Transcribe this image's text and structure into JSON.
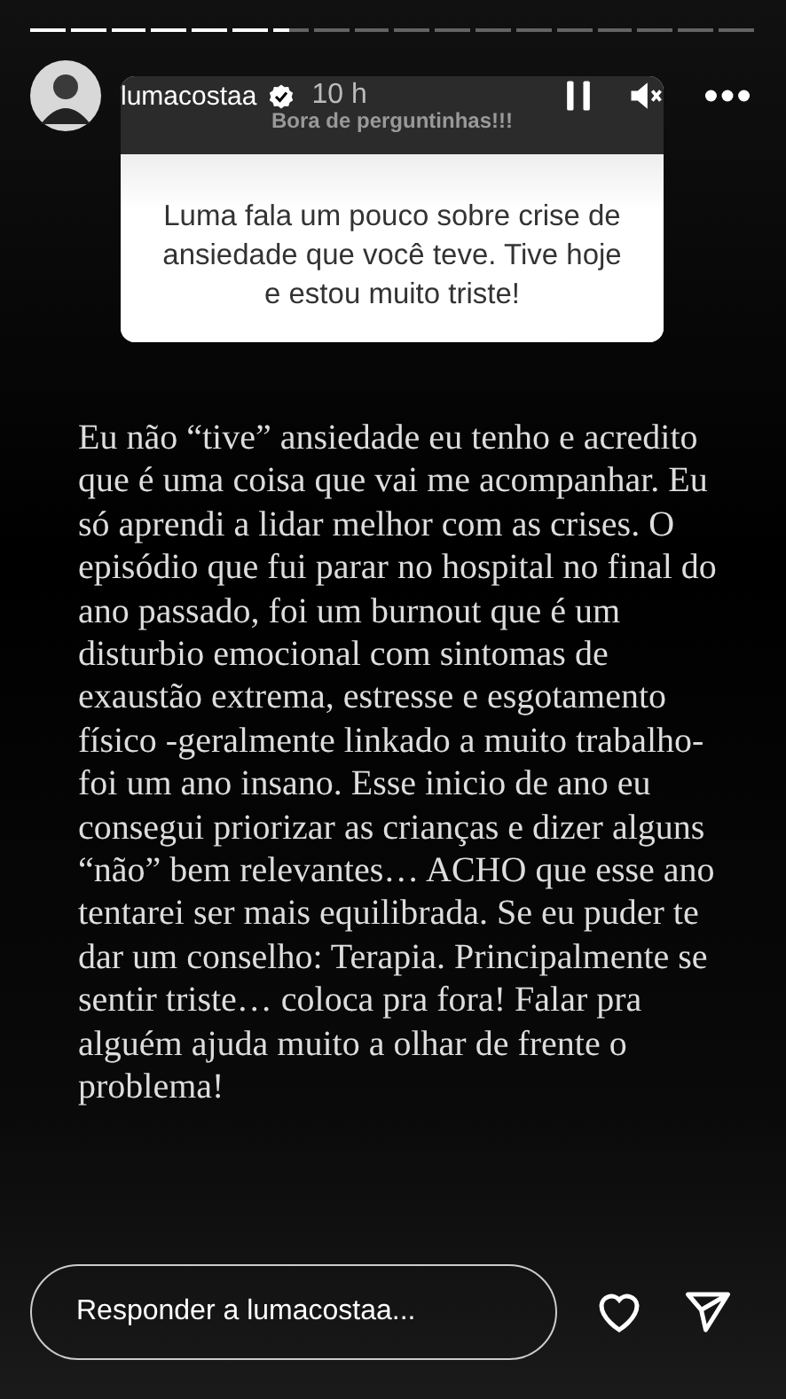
{
  "progress": [
    {
      "level": 1
    },
    {
      "level": 1
    },
    {
      "level": 1
    },
    {
      "level": 1
    },
    {
      "level": 1
    },
    {
      "level": 1
    },
    {
      "level": 0.45
    },
    {
      "level": 0
    },
    {
      "level": 0
    },
    {
      "level": 0
    },
    {
      "level": 0
    },
    {
      "level": 0
    },
    {
      "level": 0
    },
    {
      "level": 0
    },
    {
      "level": 0
    },
    {
      "level": 0
    },
    {
      "level": 0
    },
    {
      "level": 0
    }
  ],
  "header": {
    "username": "lumacostaa",
    "verified": true,
    "time": "10 h",
    "paused": true,
    "muted": true
  },
  "question_card": {
    "title": "Bora de perguntinhas!!!",
    "question": "Luma fala um pouco sobre crise de ansiedade que você teve. Tive hoje e estou muito triste!"
  },
  "answer": "Eu não “tive” ansiedade eu tenho e acredito que é uma coisa que vai me acompanhar. Eu só aprendi a lidar melhor com as crises. O episódio que fui parar no hospital no final do ano passado, foi um burnout que é um disturbio emocional com sintomas de exaustão extrema, estresse e esgotamento físico -geralmente linkado a muito trabalho- foi um ano insano. Esse inicio de ano eu consegui priorizar as crianças e dizer alguns “não” bem relevantes… ACHO que esse ano tentarei ser mais equilibrada. Se eu puder te dar um conselho: Terapia. Principalmente se sentir triste… coloca pra fora! Falar pra alguém ajuda muito a olhar de frente o problema!",
  "reply": {
    "placeholder": "Responder a lumacostaa..."
  }
}
